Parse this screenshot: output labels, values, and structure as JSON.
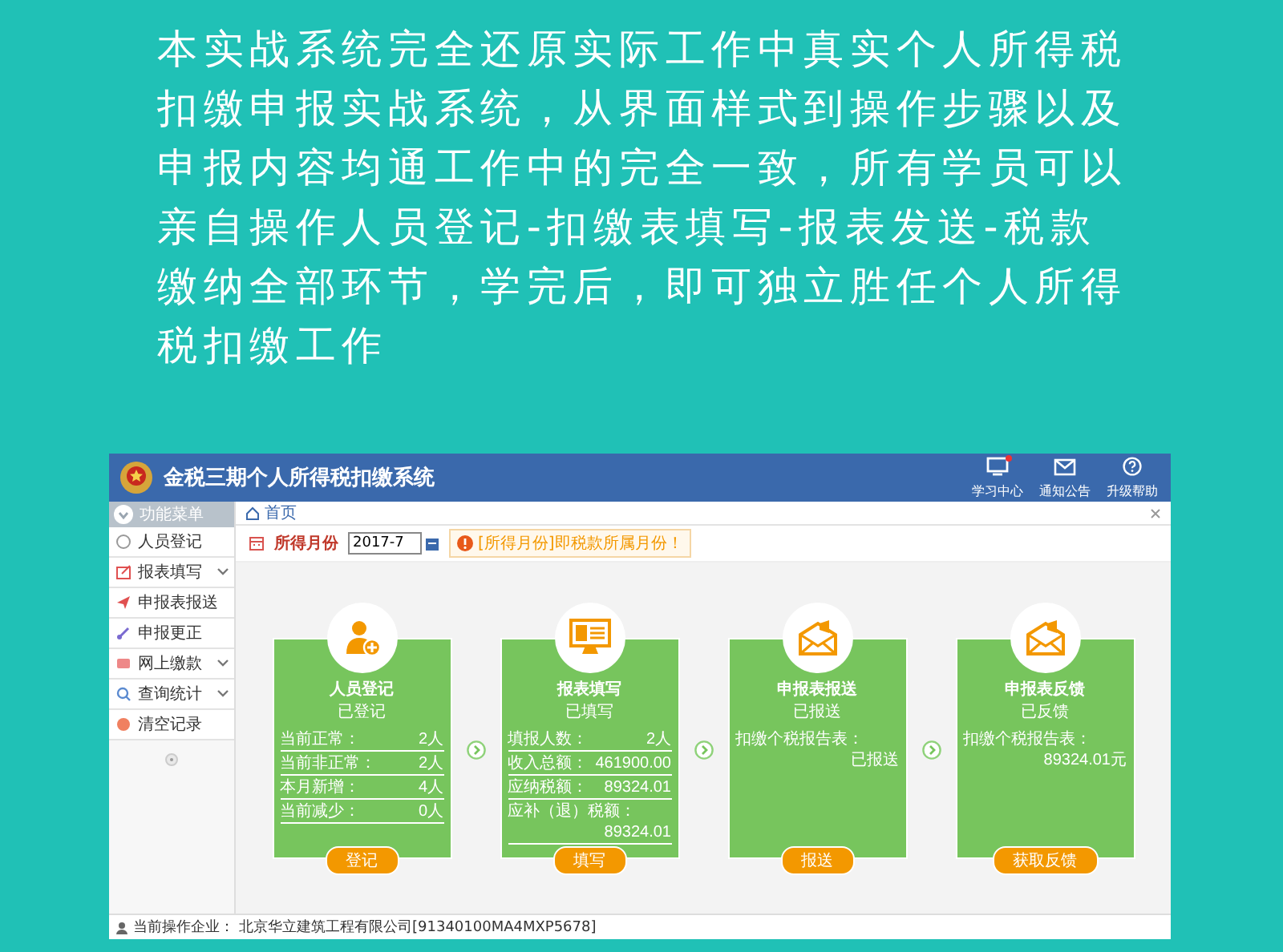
{
  "intro": "本实战系统完全还原实际工作中真实个人所得税扣缴申报实战系统，从界面样式到操作步骤以及申报内容均通工作中的完全一致，所有学员可以亲自操作人员登记-扣缴表填写-报表发送-税款缴纳全部环节，学完后，即可独立胜任个人所得税扣缴工作",
  "app": {
    "title": "金税三期个人所得税扣缴系统",
    "header_links": [
      {
        "label": "学习中心",
        "badge": true
      },
      {
        "label": "通知公告",
        "badge": false
      },
      {
        "label": "升级帮助",
        "badge": false
      }
    ],
    "sidebar": {
      "header": "功能菜单",
      "items": [
        {
          "label": "人员登记",
          "has_submenu": false
        },
        {
          "label": "报表填写",
          "has_submenu": true
        },
        {
          "label": "申报表报送",
          "has_submenu": false
        },
        {
          "label": "申报更正",
          "has_submenu": false
        },
        {
          "label": "网上缴款",
          "has_submenu": true
        },
        {
          "label": "查询统计",
          "has_submenu": true
        },
        {
          "label": "清空记录",
          "has_submenu": false
        }
      ]
    },
    "tab": {
      "label": "首页"
    },
    "filter": {
      "label": "所得月份",
      "value": "2017-7",
      "notice": "[所得月份]即税款所属月份！"
    },
    "cards": [
      {
        "title": "人员登记",
        "status": "已登记",
        "kind": "stats",
        "rows": [
          {
            "label": "当前正常：",
            "value": "2人"
          },
          {
            "label": "当前非正常：",
            "value": "2人"
          },
          {
            "label": "本月新增：",
            "value": "4人"
          },
          {
            "label": "当前减少：",
            "value": "0人"
          }
        ],
        "button": "登记"
      },
      {
        "title": "报表填写",
        "status": "已填写",
        "kind": "stats",
        "rows": [
          {
            "label": "填报人数：",
            "value": "2人"
          },
          {
            "label": "收入总额：",
            "value": "461900.00"
          },
          {
            "label": "应纳税额：",
            "value": "89324.01"
          },
          {
            "label": "应补（退）税额：",
            "value": "89324.01"
          }
        ],
        "button": "填写"
      },
      {
        "title": "申报表报送",
        "status": "已报送",
        "kind": "summary",
        "rows": [
          {
            "label": "扣缴个税报告表：",
            "value": "已报送"
          }
        ],
        "button": "报送"
      },
      {
        "title": "申报表反馈",
        "status": "已反馈",
        "kind": "summary",
        "rows": [
          {
            "label": "扣缴个税报告表：",
            "value": "89324.01元"
          }
        ],
        "button": "获取反馈"
      }
    ],
    "footer": {
      "label": "当前操作企业：",
      "company": "北京华立建筑工程有限公司[91340100MA4MXP5678]"
    }
  }
}
